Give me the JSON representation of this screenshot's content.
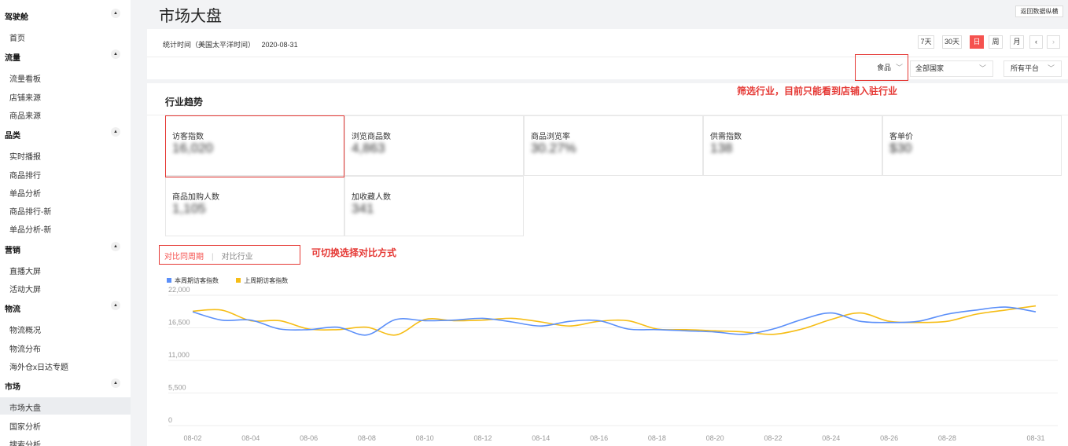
{
  "sidebar": {
    "groups": [
      {
        "title": "驾驶舱",
        "items": [
          "首页"
        ]
      },
      {
        "title": "流量",
        "items": [
          "流量看板",
          "店铺来源",
          "商品来源"
        ]
      },
      {
        "title": "品类",
        "items": [
          "实时播报",
          "商品排行",
          "单品分析",
          "商品排行-新",
          "单品分析-新"
        ]
      },
      {
        "title": "营销",
        "items": [
          "直播大屏",
          "活动大屏"
        ]
      },
      {
        "title": "物流",
        "items": [
          "物流概况",
          "物流分布",
          "海外仓x日达专题"
        ]
      },
      {
        "title": "市场",
        "items": [
          "市场大盘",
          "国家分析",
          "搜索分析"
        ]
      }
    ],
    "active_item": "市场大盘",
    "caret": "▲"
  },
  "header": {
    "title": "市场大盘",
    "back_button": "返回数据纵横"
  },
  "filters": {
    "stat_time_label": "统计时间（美国太平洋时间）",
    "stat_time_value": "2020-08-31",
    "ranges": [
      "7天",
      "30天",
      "日",
      "周",
      "月"
    ],
    "active_range": "日",
    "prev_icon": "‹",
    "next_icon": "›",
    "industry": "食品",
    "country": "全部国家",
    "platform": "所有平台",
    "chevron": "﹀"
  },
  "trend": {
    "title": "行业趋势",
    "metrics": [
      {
        "label": "访客指数",
        "value": "16,020"
      },
      {
        "label": "浏览商品数",
        "value": "4,863"
      },
      {
        "label": "商品浏览率",
        "value": "30.27%"
      },
      {
        "label": "供需指数",
        "value": "138"
      },
      {
        "label": "客单价",
        "value": "$30"
      },
      {
        "label": "商品加购人数",
        "value": "1,105"
      },
      {
        "label": "加收藏人数",
        "value": "341"
      }
    ],
    "compare_tabs": [
      "对比同周期",
      "对比行业"
    ],
    "compare_sep": "|"
  },
  "annotations": {
    "industry_note": "筛选行业，目前只能看到店铺入驻行业",
    "compare_note": "可切换选择对比方式"
  },
  "colors": {
    "accent": "#f5524f",
    "series_current": "#5b8ff9",
    "series_previous": "#f6bd16",
    "annotation": "#e53935"
  },
  "chart_data": {
    "type": "line",
    "y_ticks": [
      "22,000",
      "16,500",
      "11,000",
      "5,500",
      "0"
    ],
    "ylim": [
      0,
      22000
    ],
    "x_tick_labels": [
      "08-02",
      "08-04",
      "08-06",
      "08-08",
      "08-10",
      "08-12",
      "08-14",
      "08-16",
      "08-18",
      "08-20",
      "08-22",
      "08-24",
      "08-26",
      "08-28",
      "08-31"
    ],
    "x": [
      "08-02",
      "08-03",
      "08-04",
      "08-05",
      "08-06",
      "08-07",
      "08-08",
      "08-09",
      "08-10",
      "08-11",
      "08-12",
      "08-13",
      "08-14",
      "08-15",
      "08-16",
      "08-17",
      "08-18",
      "08-19",
      "08-20",
      "08-21",
      "08-22",
      "08-23",
      "08-24",
      "08-25",
      "08-26",
      "08-27",
      "08-28",
      "08-29",
      "08-30",
      "08-31"
    ],
    "series": [
      {
        "name": "本周期访客指数",
        "values": [
          19200,
          17800,
          17800,
          16300,
          16200,
          16600,
          15300,
          17900,
          17700,
          17800,
          18100,
          17500,
          16800,
          17600,
          17700,
          16300,
          16200,
          16000,
          15800,
          15400,
          16300,
          17900,
          19000,
          17600,
          17400,
          17600,
          18800,
          19500,
          20000,
          19200
        ]
      },
      {
        "name": "上周期访客指数",
        "values": [
          19300,
          19500,
          17700,
          17700,
          16300,
          16200,
          16600,
          15300,
          17900,
          17700,
          17800,
          18100,
          17500,
          16800,
          17600,
          17700,
          16300,
          16200,
          16000,
          15800,
          15400,
          16300,
          17900,
          19000,
          17600,
          17400,
          17600,
          18800,
          19500,
          20200
        ]
      }
    ],
    "grid": true,
    "legend_position": "top-left"
  }
}
